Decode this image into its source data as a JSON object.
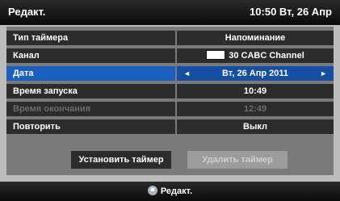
{
  "header": {
    "title": "Редакт.",
    "clock": "10:50 Вт, 26 Апр"
  },
  "rows": [
    {
      "label": "Тип таймера",
      "value": "Напоминание"
    },
    {
      "label": "Канал",
      "value": "30 CABC Channel"
    },
    {
      "label": "Дата",
      "value": "Вт, 26 Апр 2011"
    },
    {
      "label": "Время запуска",
      "value": "10:49"
    },
    {
      "label": "Время окончания",
      "value": "12:49"
    },
    {
      "label": "Повторить",
      "value": "Выкл"
    }
  ],
  "buttons": {
    "set_timer": "Установить таймер",
    "delete_timer": "Удалить таймер"
  },
  "footer": {
    "hint": "Редакт."
  },
  "icons": {
    "left_arrow": "chevron-left-icon",
    "right_arrow": "chevron-right-icon",
    "channel": "channel-icon",
    "remote": "remote-enter-icon"
  },
  "colors": {
    "selected_row": "#1a5fbf",
    "row_bg": "#2c2c2c",
    "panel_bg": "#7a7a7a"
  }
}
